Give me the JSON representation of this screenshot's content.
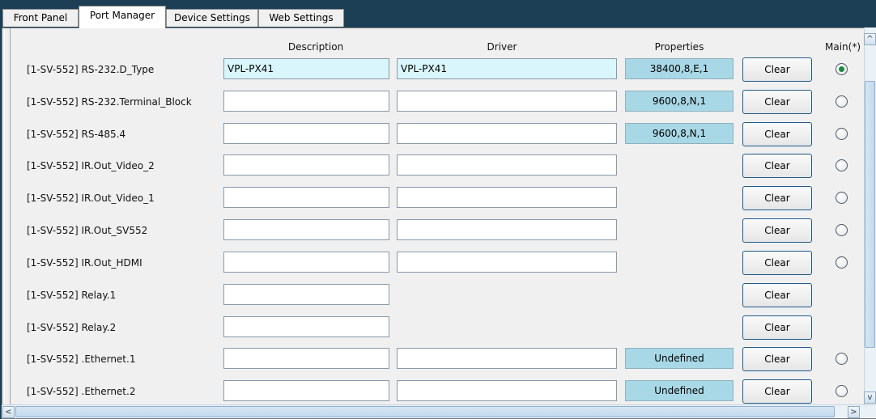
{
  "tabs": [
    {
      "label": "Front Panel",
      "active": false
    },
    {
      "label": "Port Manager",
      "active": true
    },
    {
      "label": "Device Settings",
      "active": false
    },
    {
      "label": "Web Settings",
      "active": false
    }
  ],
  "headers": {
    "description": "Description",
    "driver": "Driver",
    "properties": "Properties",
    "main": "Main(*)"
  },
  "rows": [
    {
      "label": "[1-SV-552] RS-232.D_Type",
      "description": "VPL-PX41",
      "driver": "VPL-PX41",
      "properties": "38400,8,E,1",
      "clear": "Clear",
      "main_selected": true
    },
    {
      "label": "[1-SV-552] RS-232.Terminal_Block",
      "description": "",
      "driver": "",
      "properties": "9600,8,N,1",
      "clear": "Clear",
      "main_selected": false
    },
    {
      "label": "[1-SV-552] RS-485.4",
      "description": "",
      "driver": "",
      "properties": "9600,8,N,1",
      "clear": "Clear",
      "main_selected": false
    },
    {
      "label": "[1-SV-552] IR.Out_Video_2",
      "description": "",
      "driver": "",
      "properties": null,
      "clear": "Clear",
      "main_selected": false
    },
    {
      "label": "[1-SV-552] IR.Out_Video_1",
      "description": "",
      "driver": "",
      "properties": null,
      "clear": "Clear",
      "main_selected": false
    },
    {
      "label": "[1-SV-552] IR.Out_SV552",
      "description": "",
      "driver": "",
      "properties": null,
      "clear": "Clear",
      "main_selected": false
    },
    {
      "label": "[1-SV-552] IR.Out_HDMI",
      "description": "",
      "driver": "",
      "properties": null,
      "clear": "Clear",
      "main_selected": false
    },
    {
      "label": "[1-SV-552] Relay.1",
      "description": "",
      "driver": null,
      "properties": null,
      "clear": "Clear",
      "main_selected": null
    },
    {
      "label": "[1-SV-552] Relay.2",
      "description": "",
      "driver": null,
      "properties": null,
      "clear": "Clear",
      "main_selected": null
    },
    {
      "label": "[1-SV-552] .Ethernet.1",
      "description": "",
      "driver": "",
      "properties": "Undefined",
      "clear": "Clear",
      "main_selected": false
    },
    {
      "label": "[1-SV-552] .Ethernet.2",
      "description": "",
      "driver": "",
      "properties": "Undefined",
      "clear": "Clear",
      "main_selected": false
    }
  ],
  "scrollbars": {
    "up_arrow": "^",
    "down_arrow": "v",
    "left_arrow": "<",
    "right_arrow": ">"
  },
  "colors": {
    "background": "#1c3f55",
    "panel": "#f0f0f0",
    "filled_field": "#d8f6fb",
    "properties_cell": "#a8d8e6",
    "button_border": "#1f5a8a",
    "radio_selected": "#1e8a3a"
  }
}
